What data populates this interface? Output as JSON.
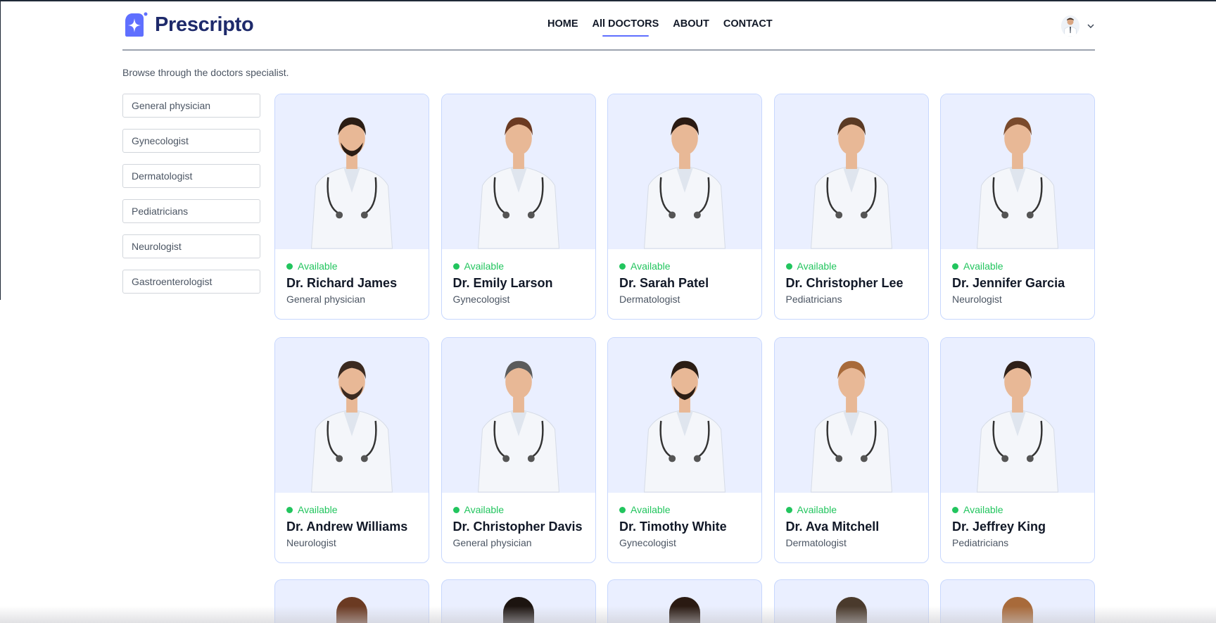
{
  "brand": {
    "name": "Prescripto",
    "accent": "#5f6fff"
  },
  "nav": {
    "links": [
      {
        "label": "HOME",
        "active": false
      },
      {
        "label": "All DOCTORS",
        "active": true
      },
      {
        "label": "ABOUT",
        "active": false
      },
      {
        "label": "CONTACT",
        "active": false
      }
    ]
  },
  "profile": {
    "avatar_icon": "doctor-avatar-icon",
    "dropdown_icon": "chevron-down-icon"
  },
  "page": {
    "subtitle": "Browse through the doctors specialist."
  },
  "filters": [
    "General physician",
    "Gynecologist",
    "Dermatologist",
    "Pediatricians",
    "Neurologist",
    "Gastroenterologist"
  ],
  "doctors": [
    {
      "name": "Dr. Richard James",
      "speciality": "General physician",
      "status": "Available",
      "hair": "#2b1d14",
      "beard": true
    },
    {
      "name": "Dr. Emily Larson",
      "speciality": "Gynecologist",
      "status": "Available",
      "hair": "#6b3a22",
      "beard": false
    },
    {
      "name": "Dr. Sarah Patel",
      "speciality": "Dermatologist",
      "status": "Available",
      "hair": "#2a1a12",
      "beard": false
    },
    {
      "name": "Dr. Christopher Lee",
      "speciality": "Pediatricians",
      "status": "Available",
      "hair": "#5a3a24",
      "beard": false
    },
    {
      "name": "Dr. Jennifer Garcia",
      "speciality": "Neurologist",
      "status": "Available",
      "hair": "#7a4a2c",
      "beard": false
    },
    {
      "name": "Dr. Andrew Williams",
      "speciality": "Neurologist",
      "status": "Available",
      "hair": "#3b2a20",
      "beard": true
    },
    {
      "name": "Dr. Christopher Davis",
      "speciality": "General physician",
      "status": "Available",
      "hair": "#5b5b5b",
      "beard": false
    },
    {
      "name": "Dr. Timothy White",
      "speciality": "Gynecologist",
      "status": "Available",
      "hair": "#2b1d14",
      "beard": true
    },
    {
      "name": "Dr. Ava Mitchell",
      "speciality": "Dermatologist",
      "status": "Available",
      "hair": "#a86a3a",
      "beard": false
    },
    {
      "name": "Dr. Jeffrey King",
      "speciality": "Pediatricians",
      "status": "Available",
      "hair": "#2f2018",
      "beard": false
    }
  ],
  "partial_row_hair": [
    "#6b3a22",
    "#1c1410",
    "#2a1a12",
    "#4a3a2c",
    "#a86a3a"
  ],
  "colors": {
    "available": "#22c55e",
    "card_bg": "#eaefff",
    "card_border": "#c7d7fe",
    "coat": "#f4f6fa",
    "skin": "#e8b896"
  }
}
